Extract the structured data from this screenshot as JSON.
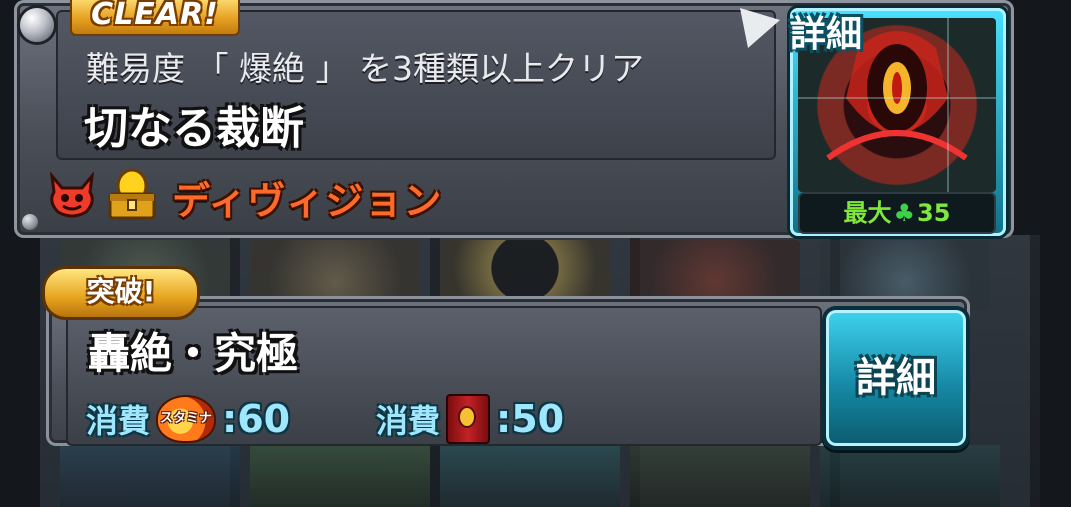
{
  "mission": {
    "clear_badge": "CLEAR!",
    "condition": "難易度 「 爆絶 」 を3種類以上クリア",
    "title": "切なる裁断",
    "element_name": "ディヴィジョン",
    "detail_label": "詳細",
    "max_label": "最大",
    "max_value": "35",
    "clover_icon": "clover-icon"
  },
  "quest": {
    "breakthrough_badge": "突破!",
    "name": "轟絶・究極",
    "cost_label_1": "消費",
    "stamina_icon_text": "スタミナ",
    "stamina_value": ":60",
    "cost_label_2": "消費",
    "book_value": ":50",
    "detail_button_label": "詳細"
  },
  "colors": {
    "accent_orange": "#ff6a2a",
    "accent_cyan": "#9fe7ff",
    "gold_badge": "#e6a020",
    "max_green": "#7fe83a"
  }
}
